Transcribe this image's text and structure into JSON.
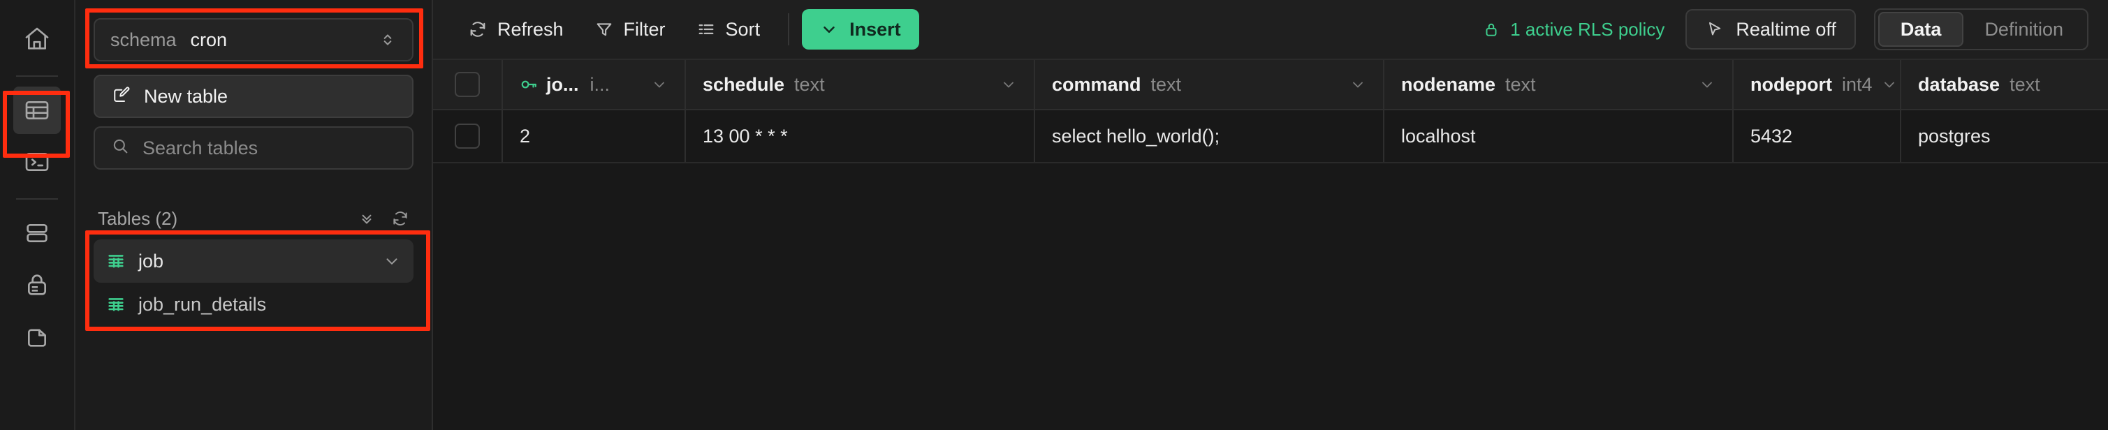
{
  "rail": {
    "items": [
      {
        "name": "home-icon",
        "label": "Home",
        "active": false
      },
      {
        "name": "table-editor-icon",
        "label": "Table Editor",
        "active": true
      },
      {
        "name": "sql-editor-icon",
        "label": "SQL Editor",
        "active": false
      },
      {
        "name": "database-icon",
        "label": "Database",
        "active": false
      },
      {
        "name": "auth-lock-icon",
        "label": "Authentication",
        "active": false
      },
      {
        "name": "storage-icon",
        "label": "Storage",
        "active": false
      }
    ]
  },
  "sidebar": {
    "schema": {
      "label": "schema",
      "value": "cron"
    },
    "new_table_label": "New table",
    "search_placeholder": "Search tables",
    "tables_heading": "Tables (2)",
    "tables": [
      {
        "name": "job",
        "selected": true
      },
      {
        "name": "job_run_details",
        "selected": false
      }
    ]
  },
  "toolbar": {
    "refresh_label": "Refresh",
    "filter_label": "Filter",
    "sort_label": "Sort",
    "insert_label": "Insert",
    "rls_label": "1 active RLS policy",
    "realtime_label": "Realtime off",
    "tabs": [
      {
        "label": "Data",
        "active": true
      },
      {
        "label": "Definition",
        "active": false
      }
    ]
  },
  "colors": {
    "accent_green": "#3ecf8e",
    "highlight_red": "#ff2d0f",
    "bg": "#181818",
    "panel": "#1c1c1c"
  },
  "table": {
    "columns": [
      {
        "name": "jo...",
        "type": "i...",
        "primary_key": true,
        "sortable": false
      },
      {
        "name": "schedule",
        "type": "text",
        "primary_key": false,
        "sortable": true
      },
      {
        "name": "command",
        "type": "text",
        "primary_key": false,
        "sortable": true
      },
      {
        "name": "nodename",
        "type": "text",
        "primary_key": false,
        "sortable": true
      },
      {
        "name": "nodeport",
        "type": "int4",
        "primary_key": false,
        "sortable": true
      },
      {
        "name": "database",
        "type": "text",
        "primary_key": false,
        "sortable": false
      }
    ],
    "rows": [
      {
        "jobid": "2",
        "schedule": "13 00 * * *",
        "command": "select hello_world();",
        "nodename": "localhost",
        "nodeport": "5432",
        "database": "postgres"
      }
    ]
  }
}
